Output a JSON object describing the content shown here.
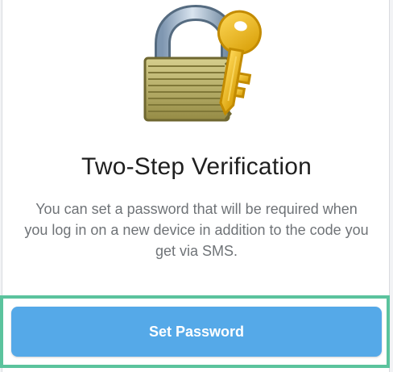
{
  "content": {
    "title": "Two-Step Verification",
    "description": "You can set a password that will be required when you log in on a new device in addition to the code you get via SMS."
  },
  "actions": {
    "set_password_label": "Set Password"
  },
  "icons": {
    "hero": "padlock-and-key-icon"
  },
  "colors": {
    "primary_button": "#55a9e8",
    "highlight_border": "#5bc39d",
    "title_text": "#1f1f1f",
    "body_text": "#6f7377"
  }
}
